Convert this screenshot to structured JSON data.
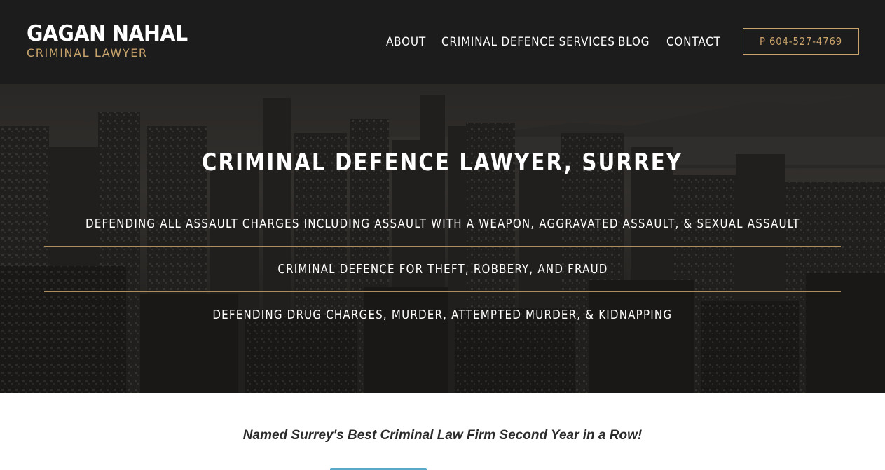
{
  "logo": {
    "name": "GAGAN NAHAL",
    "subtitle": "CRIMINAL LAWYER"
  },
  "nav": {
    "items": [
      {
        "label": "ABOUT"
      },
      {
        "label": "CRIMINAL DEFENCE SERVICES"
      },
      {
        "label": "BLOG"
      },
      {
        "label": "CONTACT"
      }
    ],
    "phone_label": "P  604-527-4769"
  },
  "hero": {
    "title": "CRIMINAL DEFENCE LAWYER, SURREY",
    "services": [
      {
        "text": "DEFENDING ALL ASSAULT CHARGES INCLUDING ASSAULT WITH A WEAPON, AGGRAVATED ASSAULT, & SEXUAL ASSAULT"
      },
      {
        "text": "CRIMINAL DEFENCE FOR THEFT, ROBBERY, AND FRAUD"
      },
      {
        "text": "DEFENDING DRUG CHARGES, MURDER, ATTEMPTED MURDER, & KIDNAPPING"
      }
    ],
    "background_description_icon": "city-skyline-image"
  },
  "main": {
    "tagline": "Named Surrey's Best Criminal Law Firm Second Year in a Row!"
  },
  "colors": {
    "header_bg": "#1c1c1c",
    "accent_gold": "#c9a46c",
    "divider_gold": "#b08d5c",
    "text_white": "#ffffff",
    "tagline_text": "#2b2b2b",
    "cta_blue": "#5aa9c9"
  }
}
